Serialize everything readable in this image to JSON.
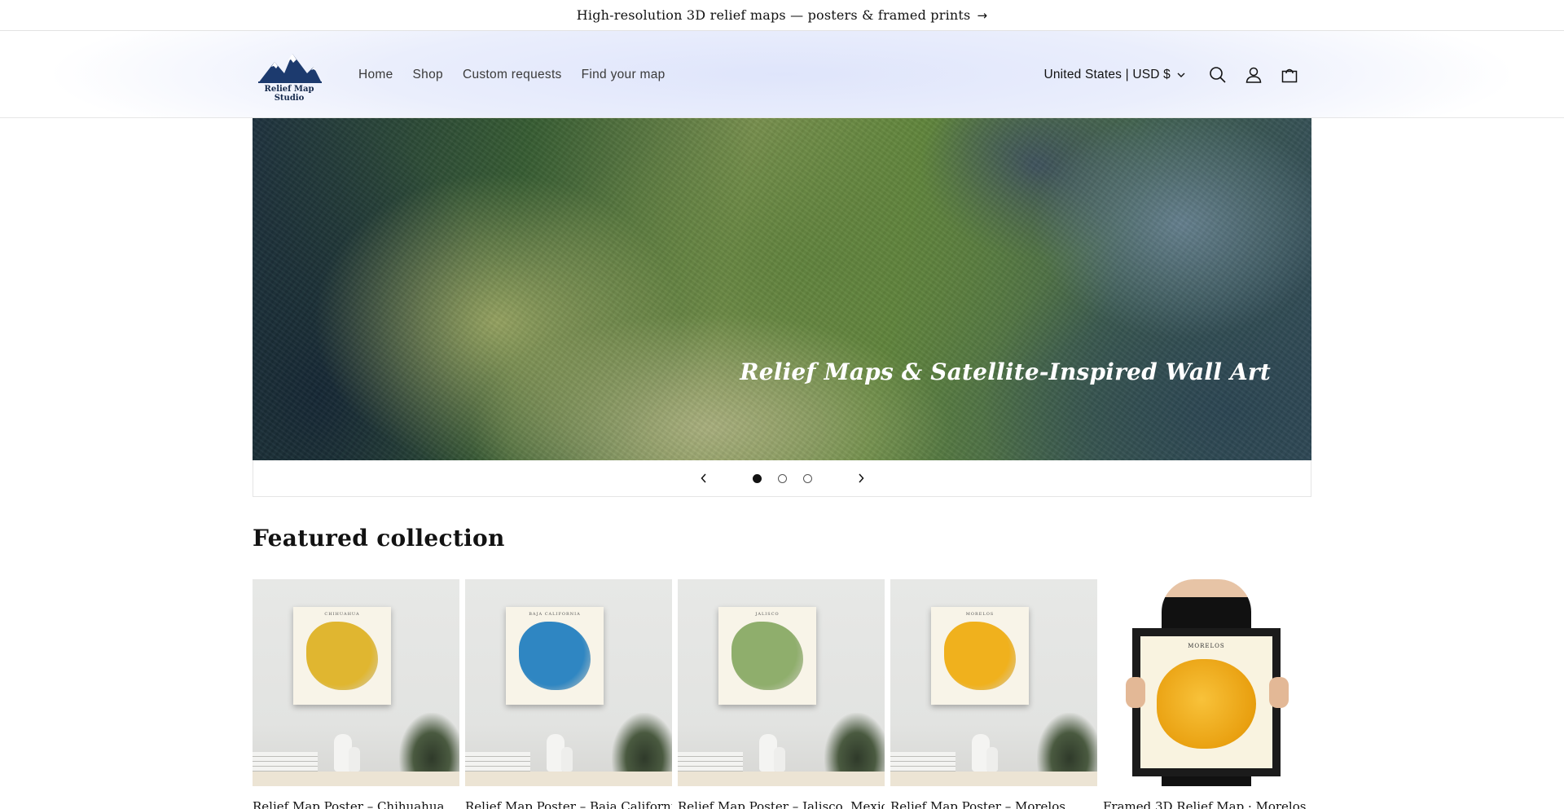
{
  "announcement": {
    "text": "High-resolution 3D relief maps — posters & framed prints",
    "arrow": "→"
  },
  "header": {
    "logo_text_line1": "Relief Map",
    "logo_text_line2": "Studio",
    "nav": [
      {
        "label": "Home"
      },
      {
        "label": "Shop"
      },
      {
        "label": "Custom requests"
      },
      {
        "label": "Find your map"
      }
    ],
    "locale": "United States | USD $",
    "icons": [
      "search-icon",
      "account-icon",
      "cart-icon"
    ]
  },
  "hero": {
    "title": "Relief Maps & Satellite-Inspired Wall Art",
    "slides_count": 3,
    "active_slide": 1
  },
  "featured": {
    "title": "Featured collection",
    "products": [
      {
        "caption": "Relief Map Poster – Chihuahua",
        "poster_label": "CHIHUAHUA",
        "map_color": "#e0b630"
      },
      {
        "caption": "Relief Map Poster – Baja California",
        "poster_label": "BAJA CALIFORNIA",
        "map_color": "#2f86c2"
      },
      {
        "caption": "Relief Map Poster – Jalisco, Mexico",
        "poster_label": "JALISCO",
        "map_color": "#8fae6c"
      },
      {
        "caption": "Relief Map Poster – Morelos",
        "poster_label": "MORELOS",
        "map_color": "#f0b11d"
      },
      {
        "caption": "Framed 3D Relief Map · Morelos",
        "poster_label": "MORELOS",
        "map_color": "#f2b523"
      }
    ]
  },
  "colors": {
    "accent": "#121212",
    "header_bg": "#eaeefc",
    "logo_blue": "#1c3a6e"
  }
}
